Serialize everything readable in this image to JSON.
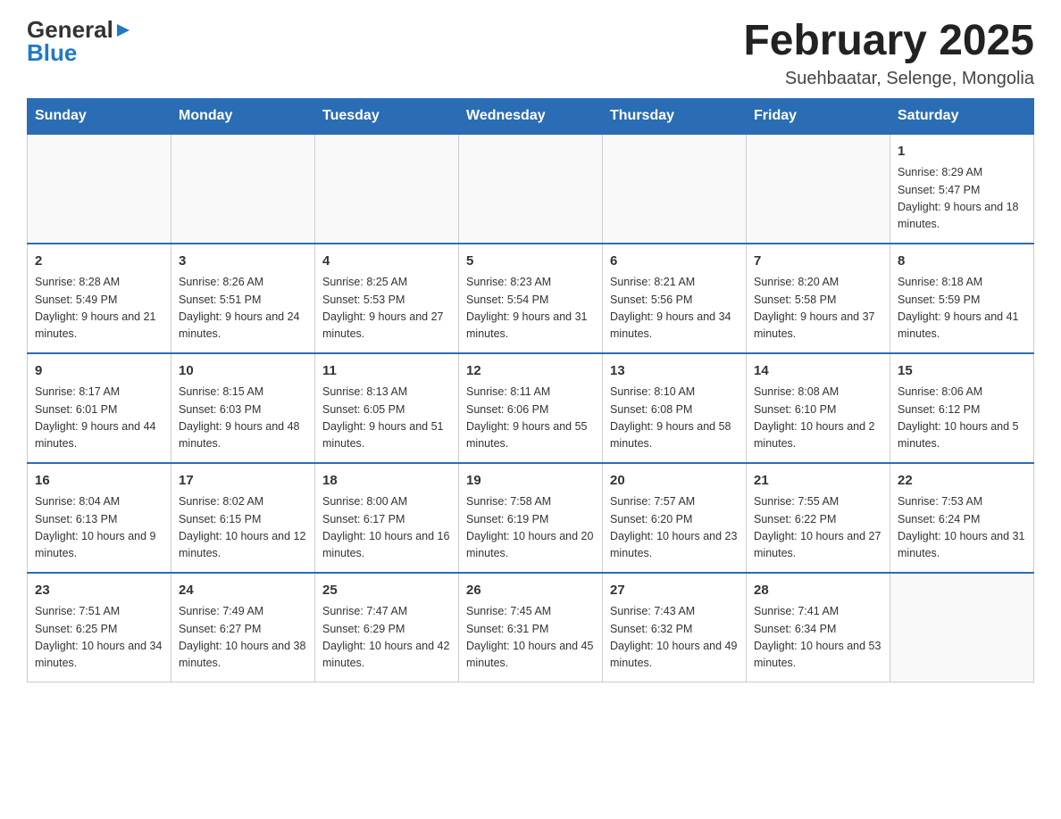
{
  "header": {
    "logo": {
      "general": "General",
      "blue": "Blue",
      "triangle": "▶"
    },
    "title": "February 2025",
    "subtitle": "Suehbaatar, Selenge, Mongolia"
  },
  "weekdays": [
    "Sunday",
    "Monday",
    "Tuesday",
    "Wednesday",
    "Thursday",
    "Friday",
    "Saturday"
  ],
  "weeks": [
    [
      {
        "day": "",
        "info": ""
      },
      {
        "day": "",
        "info": ""
      },
      {
        "day": "",
        "info": ""
      },
      {
        "day": "",
        "info": ""
      },
      {
        "day": "",
        "info": ""
      },
      {
        "day": "",
        "info": ""
      },
      {
        "day": "1",
        "info": "Sunrise: 8:29 AM\nSunset: 5:47 PM\nDaylight: 9 hours and 18 minutes."
      }
    ],
    [
      {
        "day": "2",
        "info": "Sunrise: 8:28 AM\nSunset: 5:49 PM\nDaylight: 9 hours and 21 minutes."
      },
      {
        "day": "3",
        "info": "Sunrise: 8:26 AM\nSunset: 5:51 PM\nDaylight: 9 hours and 24 minutes."
      },
      {
        "day": "4",
        "info": "Sunrise: 8:25 AM\nSunset: 5:53 PM\nDaylight: 9 hours and 27 minutes."
      },
      {
        "day": "5",
        "info": "Sunrise: 8:23 AM\nSunset: 5:54 PM\nDaylight: 9 hours and 31 minutes."
      },
      {
        "day": "6",
        "info": "Sunrise: 8:21 AM\nSunset: 5:56 PM\nDaylight: 9 hours and 34 minutes."
      },
      {
        "day": "7",
        "info": "Sunrise: 8:20 AM\nSunset: 5:58 PM\nDaylight: 9 hours and 37 minutes."
      },
      {
        "day": "8",
        "info": "Sunrise: 8:18 AM\nSunset: 5:59 PM\nDaylight: 9 hours and 41 minutes."
      }
    ],
    [
      {
        "day": "9",
        "info": "Sunrise: 8:17 AM\nSunset: 6:01 PM\nDaylight: 9 hours and 44 minutes."
      },
      {
        "day": "10",
        "info": "Sunrise: 8:15 AM\nSunset: 6:03 PM\nDaylight: 9 hours and 48 minutes."
      },
      {
        "day": "11",
        "info": "Sunrise: 8:13 AM\nSunset: 6:05 PM\nDaylight: 9 hours and 51 minutes."
      },
      {
        "day": "12",
        "info": "Sunrise: 8:11 AM\nSunset: 6:06 PM\nDaylight: 9 hours and 55 minutes."
      },
      {
        "day": "13",
        "info": "Sunrise: 8:10 AM\nSunset: 6:08 PM\nDaylight: 9 hours and 58 minutes."
      },
      {
        "day": "14",
        "info": "Sunrise: 8:08 AM\nSunset: 6:10 PM\nDaylight: 10 hours and 2 minutes."
      },
      {
        "day": "15",
        "info": "Sunrise: 8:06 AM\nSunset: 6:12 PM\nDaylight: 10 hours and 5 minutes."
      }
    ],
    [
      {
        "day": "16",
        "info": "Sunrise: 8:04 AM\nSunset: 6:13 PM\nDaylight: 10 hours and 9 minutes."
      },
      {
        "day": "17",
        "info": "Sunrise: 8:02 AM\nSunset: 6:15 PM\nDaylight: 10 hours and 12 minutes."
      },
      {
        "day": "18",
        "info": "Sunrise: 8:00 AM\nSunset: 6:17 PM\nDaylight: 10 hours and 16 minutes."
      },
      {
        "day": "19",
        "info": "Sunrise: 7:58 AM\nSunset: 6:19 PM\nDaylight: 10 hours and 20 minutes."
      },
      {
        "day": "20",
        "info": "Sunrise: 7:57 AM\nSunset: 6:20 PM\nDaylight: 10 hours and 23 minutes."
      },
      {
        "day": "21",
        "info": "Sunrise: 7:55 AM\nSunset: 6:22 PM\nDaylight: 10 hours and 27 minutes."
      },
      {
        "day": "22",
        "info": "Sunrise: 7:53 AM\nSunset: 6:24 PM\nDaylight: 10 hours and 31 minutes."
      }
    ],
    [
      {
        "day": "23",
        "info": "Sunrise: 7:51 AM\nSunset: 6:25 PM\nDaylight: 10 hours and 34 minutes."
      },
      {
        "day": "24",
        "info": "Sunrise: 7:49 AM\nSunset: 6:27 PM\nDaylight: 10 hours and 38 minutes."
      },
      {
        "day": "25",
        "info": "Sunrise: 7:47 AM\nSunset: 6:29 PM\nDaylight: 10 hours and 42 minutes."
      },
      {
        "day": "26",
        "info": "Sunrise: 7:45 AM\nSunset: 6:31 PM\nDaylight: 10 hours and 45 minutes."
      },
      {
        "day": "27",
        "info": "Sunrise: 7:43 AM\nSunset: 6:32 PM\nDaylight: 10 hours and 49 minutes."
      },
      {
        "day": "28",
        "info": "Sunrise: 7:41 AM\nSunset: 6:34 PM\nDaylight: 10 hours and 53 minutes."
      },
      {
        "day": "",
        "info": ""
      }
    ]
  ]
}
